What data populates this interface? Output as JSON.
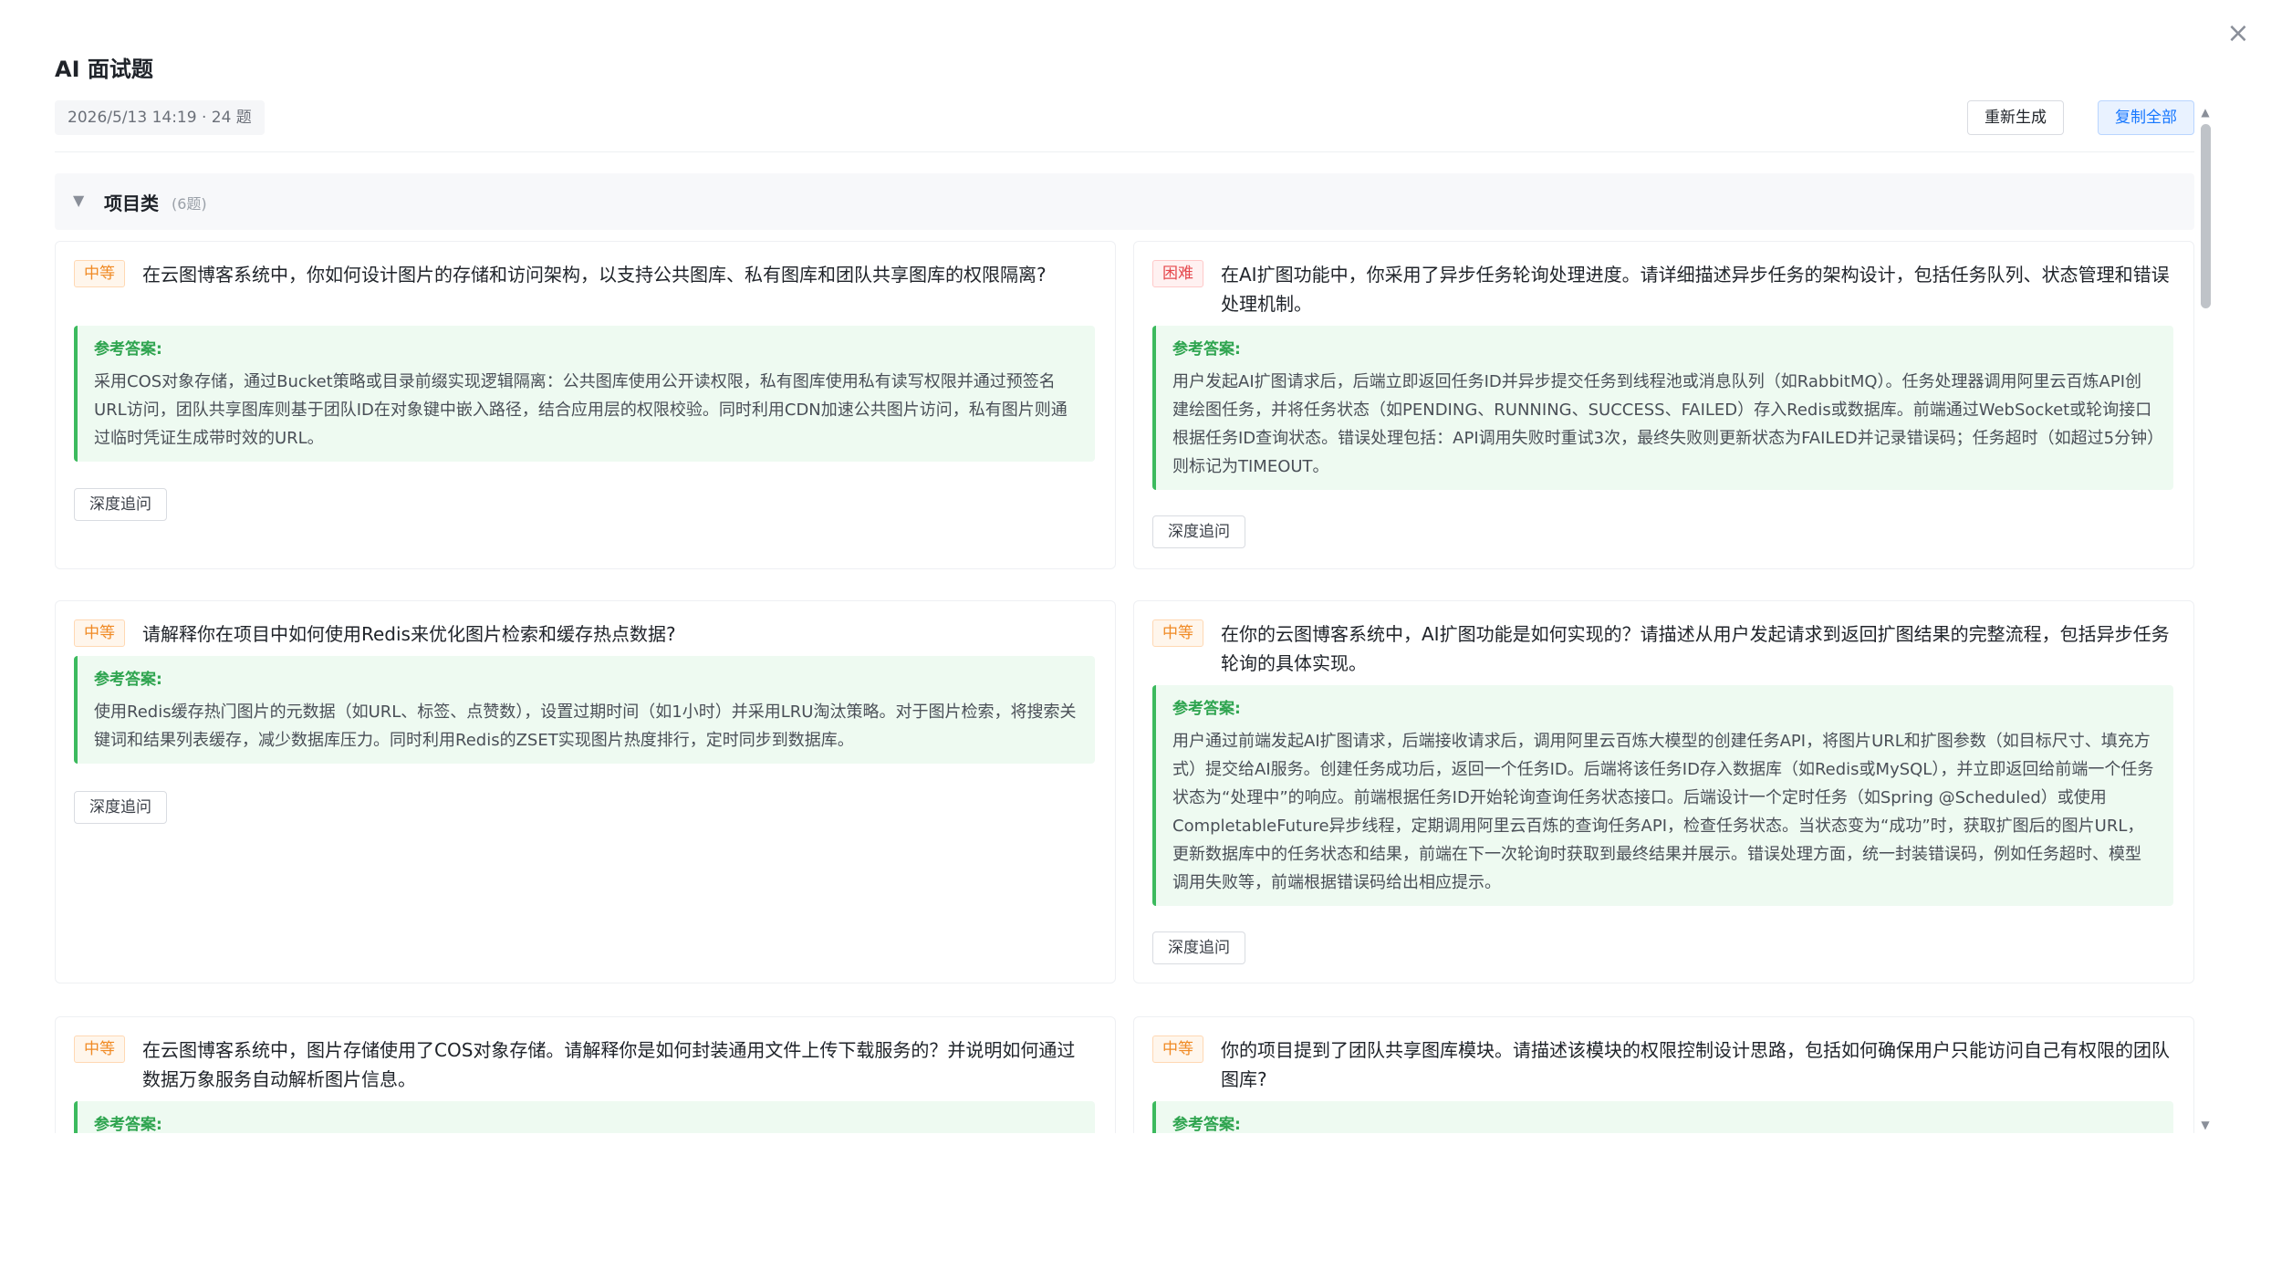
{
  "dialog": {
    "title": "AI 面试题",
    "meta": "2026/5/13 14:19 · 24 题",
    "regenerate_label": "重新生成",
    "copy_all_label": "复制全部",
    "close_icon": "×"
  },
  "section": {
    "toggle": "▼",
    "title": "项目类",
    "count": "(6题)"
  },
  "answer_label": "参考答案:",
  "followup_label": "深度追问",
  "questions": [
    {
      "difficulty": "中等",
      "question": "在云图博客系统中，你如何设计图片的存储和访问架构，以支持公共图库、私有图库和团队共享图库的权限隔离?",
      "answer": "采用COS对象存储，通过Bucket策略或目录前缀实现逻辑隔离：公共图库使用公开读权限，私有图库使用私有读写权限并通过预签名URL访问，团队共享图库则基于团队ID在对象键中嵌入路径，结合应用层的权限校验。同时利用CDN加速公共图片访问，私有图片则通过临时凭证生成带时效的URL。"
    },
    {
      "difficulty": "困难",
      "question": "在AI扩图功能中，你采用了异步任务轮询处理进度。请详细描述异步任务的架构设计，包括任务队列、状态管理和错误处理机制。",
      "answer": "用户发起AI扩图请求后，后端立即返回任务ID并异步提交任务到线程池或消息队列（如RabbitMQ）。任务处理器调用阿里云百炼API创建绘图任务，并将任务状态（如PENDING、RUNNING、SUCCESS、FAILED）存入Redis或数据库。前端通过WebSocket或轮询接口根据任务ID查询状态。错误处理包括：API调用失败时重试3次，最终失败则更新状态为FAILED并记录错误码；任务超时（如超过5分钟）则标记为TIMEOUT。"
    },
    {
      "difficulty": "中等",
      "question": "请解释你在项目中如何使用Redis来优化图片检索和缓存热点数据?",
      "answer": "使用Redis缓存热门图片的元数据（如URL、标签、点赞数），设置过期时间（如1小时）并采用LRU淘汰策略。对于图片检索，将搜索关键词和结果列表缓存，减少数据库压力。同时利用Redis的ZSET实现图片热度排行，定时同步到数据库。"
    },
    {
      "difficulty": "中等",
      "question": "在你的云图博客系统中，AI扩图功能是如何实现的？请描述从用户发起请求到返回扩图结果的完整流程，包括异步任务轮询的具体实现。",
      "answer": "用户通过前端发起AI扩图请求，后端接收请求后，调用阿里云百炼大模型的创建任务API，将图片URL和扩图参数（如目标尺寸、填充方式）提交给AI服务。创建任务成功后，返回一个任务ID。后端将该任务ID存入数据库（如Redis或MySQL），并立即返回给前端一个任务状态为“处理中”的响应。前端根据任务ID开始轮询查询任务状态接口。后端设计一个定时任务（如Spring @Scheduled）或使用CompletableFuture异步线程，定期调用阿里云百炼的查询任务API，检查任务状态。当状态变为“成功”时，获取扩图后的图片URL，更新数据库中的任务状态和结果，前端在下一次轮询时获取到最终结果并展示。错误处理方面，统一封装错误码，例如任务超时、模型调用失败等，前端根据错误码给出相应提示。"
    },
    {
      "difficulty": "中等",
      "question": "在云图博客系统中，图片存储使用了COS对象存储。请解释你是如何封装通用文件上传下载服务的？并说明如何通过数据万象服务自动解析图片信息。",
      "answer": ""
    },
    {
      "difficulty": "中等",
      "question": "你的项目提到了团队共享图库模块。请描述该模块的权限控制设计思路，包括如何确保用户只能访问自己有权限的团队图库?",
      "answer": ""
    }
  ]
}
